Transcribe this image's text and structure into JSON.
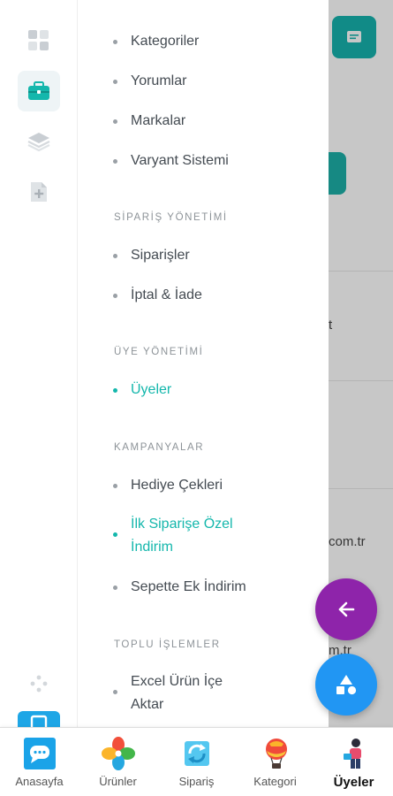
{
  "background": {
    "text_fragment_1": "t",
    "text_fragment_2": "com.tr",
    "text_fragment_3": "m.tr"
  },
  "rail": {
    "items": [
      {
        "icon": "dashboard-grid-icon"
      },
      {
        "icon": "briefcase-icon",
        "active": true
      },
      {
        "icon": "layers-icon"
      },
      {
        "icon": "add-document-icon"
      }
    ],
    "bottom_icon": "diamond-dots-icon"
  },
  "menu": {
    "items_top": [
      {
        "label": "Kategoriler"
      },
      {
        "label": "Yorumlar"
      },
      {
        "label": "Markalar"
      },
      {
        "label": "Varyant Sistemi"
      }
    ],
    "sections": {
      "siparis": "SİPARİŞ YÖNETİMİ",
      "uye": "ÜYE YÖNETİMİ",
      "kampanya": "KAMPANYALAR",
      "toplu": "TOPLU İŞLEMLER"
    },
    "siparis_items": [
      {
        "label": "Siparişler"
      },
      {
        "label": "İptal & İade"
      }
    ],
    "uye_items": [
      {
        "label": "Üyeler",
        "active": true
      }
    ],
    "kampanya_items": [
      {
        "label": "Hediye Çekleri"
      },
      {
        "label_line1": "İlk Siparişe Özel",
        "label_line2": "İndirim",
        "active": true
      },
      {
        "label": "Sepette Ek İndirim"
      }
    ],
    "toplu_items": [
      {
        "label_line1": "Excel Ürün İçe",
        "label_line2": "Aktar"
      }
    ]
  },
  "fabs": {
    "back_icon": "arrow-left-icon",
    "shapes_icon": "shapes-icon"
  },
  "bottom_nav": [
    {
      "label": "Anasayfa",
      "icon": "home-chat-icon"
    },
    {
      "label": "Ürünler",
      "icon": "colorful-pinwheel-icon"
    },
    {
      "label": "Sipariş",
      "icon": "refresh-box-icon"
    },
    {
      "label": "Kategori",
      "icon": "hot-air-balloon-icon"
    },
    {
      "label": "Üyeler",
      "icon": "person-icon",
      "active": true
    }
  ],
  "colors": {
    "accent": "#14b7ac",
    "fab_back": "#8e24aa",
    "fab_shapes": "#2196f3"
  }
}
